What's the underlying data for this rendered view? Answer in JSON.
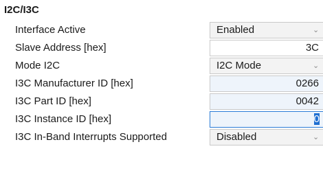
{
  "section": {
    "title": "I2C/I3C"
  },
  "rows": [
    {
      "label": "Interface Active",
      "value": "Enabled"
    },
    {
      "label": "Slave Address [hex]",
      "value": "3C"
    },
    {
      "label": "Mode I2C",
      "value": "I2C Mode"
    },
    {
      "label": "I3C Manufacturer ID [hex]",
      "value": "0266"
    },
    {
      "label": "I3C Part ID [hex]",
      "value": "0042"
    },
    {
      "label": "I3C Instance ID [hex]",
      "value": "0"
    },
    {
      "label": "I3C In-Band Interrupts Supported",
      "value": "Disabled"
    }
  ],
  "icons": {
    "dropdown": "chevron-down-icon"
  }
}
